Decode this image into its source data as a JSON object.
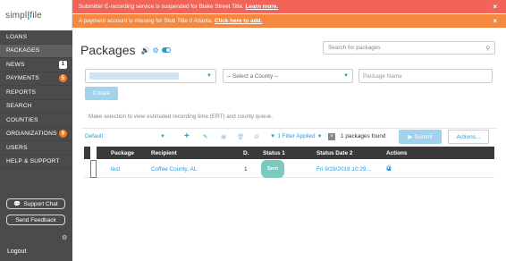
{
  "brand": {
    "logo_text": "simpl",
    "logo_bar": "|",
    "logo_tail": "file"
  },
  "sidebar": {
    "items": [
      {
        "label": "LOANS",
        "badge": ""
      },
      {
        "label": "PACKAGES",
        "badge": "",
        "active": true
      },
      {
        "label": "NEWS",
        "badge": "1"
      },
      {
        "label": "PAYMENTS",
        "badge": "5"
      },
      {
        "label": "REPORTS",
        "badge": ""
      },
      {
        "label": "SEARCH",
        "badge": ""
      },
      {
        "label": "COUNTIES",
        "badge": ""
      },
      {
        "label": "ORGANIZATIONS",
        "badge": "9"
      },
      {
        "label": "USERS",
        "badge": ""
      },
      {
        "label": "HELP & SUPPORT",
        "badge": ""
      }
    ],
    "support_chat": "Support Chat",
    "send_feedback": "Send Feedback",
    "logout": "Logout"
  },
  "banners": {
    "red_text": "Submitter E-recording service is suspended for Blake Street Title.",
    "red_link": "Learn more.",
    "orange_text": "A payment account is missing for Stub Title II Atlanta.",
    "orange_link": "Click here to add."
  },
  "page": {
    "title": "Packages",
    "search_placeholder": "Search for packages",
    "county_select": "-- Select a County --",
    "package_name_placeholder": "Package Name",
    "create_label": "Create",
    "hint": "Make selection to view estimated recording time (ERT) and county queue."
  },
  "toolbar": {
    "view": "Default",
    "filter_label": "1 Filter Applied",
    "found_text": "1 packages found",
    "submit_label": "Submit",
    "actions_label": "Actions..."
  },
  "table": {
    "headers": {
      "package": "Package",
      "recipient": "Recipient",
      "d": "D.",
      "status": "Status 1",
      "status_date": "Status Date 2",
      "actions": "Actions"
    },
    "rows": [
      {
        "package": "test",
        "recipient": "Coffee County, AL",
        "d": "1",
        "status": "Sent",
        "status_date": "Fri 9/28/2018 10:29..."
      }
    ]
  },
  "colors": {
    "accent": "#2a9bd8",
    "sidebar": "#4b4b4b",
    "banner_red": "#f16457",
    "banner_orange": "#f5883e",
    "badge_orange": "#f07a22"
  }
}
